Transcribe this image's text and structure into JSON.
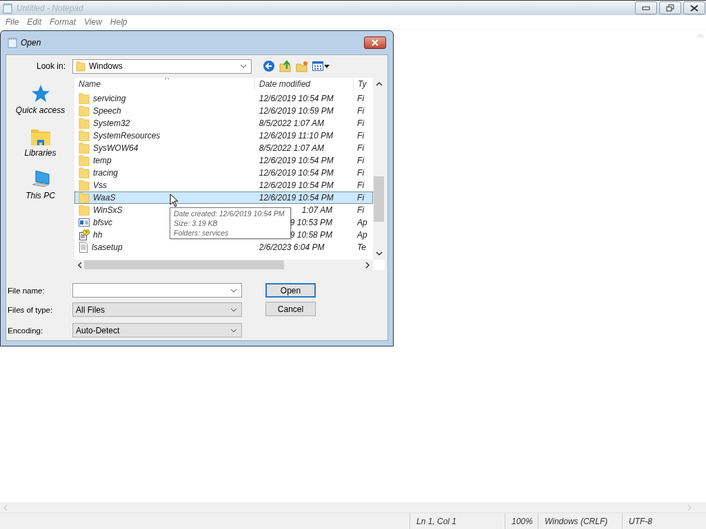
{
  "window": {
    "title": "Untitled - Notepad"
  },
  "menu": [
    "File",
    "Edit",
    "Format",
    "View",
    "Help"
  ],
  "dialog": {
    "title": "Open",
    "look_in": {
      "label": "Look in:",
      "value": "Windows"
    },
    "places": [
      {
        "label": "Quick access",
        "kind": "star"
      },
      {
        "label": "Libraries",
        "kind": "libraries"
      },
      {
        "label": "This PC",
        "kind": "pc"
      }
    ],
    "columns": [
      "Name",
      "Date modified",
      "Ty"
    ],
    "rows": [
      {
        "name": "servicing",
        "kind": "folder",
        "date": "12/6/2019 10:54 PM",
        "type": "Fi",
        "selected": false,
        "covered": false
      },
      {
        "name": "Speech",
        "kind": "folder",
        "date": "12/6/2019 10:59 PM",
        "type": "Fi",
        "selected": false,
        "covered": false
      },
      {
        "name": "System32",
        "kind": "folder",
        "date": "8/5/2022 1:07 AM",
        "type": "Fi",
        "selected": false,
        "covered": false
      },
      {
        "name": "SystemResources",
        "kind": "folder",
        "date": "12/6/2019 11:10 PM",
        "type": "Fi",
        "selected": false,
        "covered": false
      },
      {
        "name": "SysWOW64",
        "kind": "folder",
        "date": "8/5/2022 1:07 AM",
        "type": "Fi",
        "selected": false,
        "covered": false
      },
      {
        "name": "temp",
        "kind": "folder",
        "date": "12/6/2019 10:54 PM",
        "type": "Fi",
        "selected": false,
        "covered": false
      },
      {
        "name": "tracing",
        "kind": "folder",
        "date": "12/6/2019 10:54 PM",
        "type": "Fi",
        "selected": false,
        "covered": false
      },
      {
        "name": "Vss",
        "kind": "folder",
        "date": "12/6/2019 10:54 PM",
        "type": "Fi",
        "selected": false,
        "covered": false
      },
      {
        "name": "WaaS",
        "kind": "folder",
        "date": "12/6/2019 10:54 PM",
        "type": "Fi",
        "selected": true,
        "covered": false
      },
      {
        "name": "WinSxS",
        "kind": "folder",
        "date": "1:07 AM",
        "type": "Fi",
        "selected": false,
        "covered": true
      },
      {
        "name": "bfsvc",
        "kind": "app",
        "date": "9 10:53 PM",
        "type": "Ap",
        "selected": false,
        "covered": true
      },
      {
        "name": "hh",
        "kind": "help",
        "date": "9 10:58 PM",
        "type": "Ap",
        "selected": false,
        "covered": true
      },
      {
        "name": "lsasetup",
        "kind": "text",
        "date": "2/6/2023 6:04 PM",
        "type": "Te",
        "selected": false,
        "covered": false
      }
    ],
    "tooltip": [
      "Date created: 12/6/2019 10:54 PM",
      "Size: 3.19 KB",
      "Folders: services"
    ],
    "file_name": {
      "label": "File name:"
    },
    "file_type": {
      "label": "Files of type:",
      "value": "All Files"
    },
    "encoding": {
      "label": "Encoding:",
      "value": "Auto-Detect"
    },
    "buttons": [
      {
        "label": "Open",
        "default": true
      },
      {
        "label": "Cancel",
        "default": false
      }
    ]
  },
  "status_bar": [
    "Ln 1, Col 1",
    "100%",
    "Windows (CRLF)",
    "UTF-8"
  ]
}
